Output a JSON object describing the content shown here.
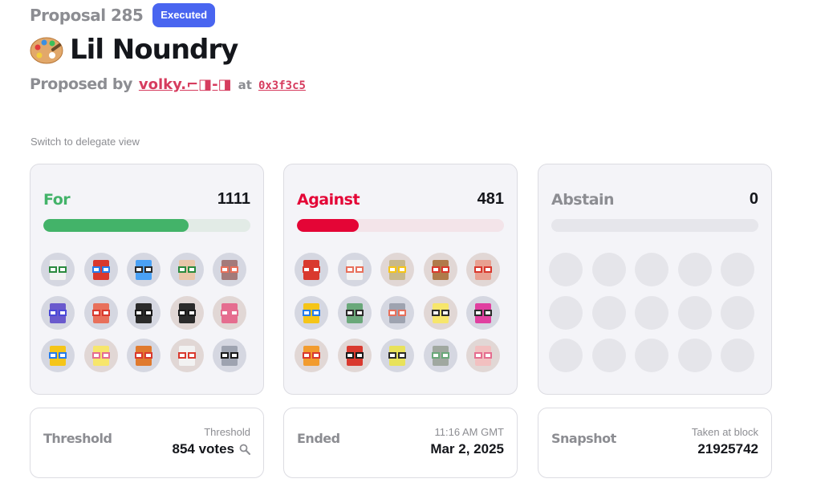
{
  "proposal": {
    "number_label": "Proposal 285",
    "status_badge": "Executed",
    "title": "Lil Noundry",
    "proposed_by_label": "Proposed by",
    "proposer": "volky.⌐◨-◨",
    "at_label": "at",
    "address": "0x3f3c5"
  },
  "switch_view": "Switch to delegate view",
  "votes": {
    "for": {
      "label": "For",
      "count": "1111",
      "fraction": 0.7,
      "color": "#43b369",
      "track": "#e2ebe6"
    },
    "against": {
      "label": "Against",
      "count": "481",
      "fraction": 0.3,
      "color": "#e40536",
      "track": "#f3e4e9"
    },
    "abstain": {
      "label": "Abstain",
      "count": "0",
      "fraction": 0,
      "color": "#8c8d92",
      "track": "#e6e6eb"
    }
  },
  "voter_avatars": {
    "for": [
      {
        "bg": "#d5d7e1",
        "head": "#f2f2f2",
        "glass": "#2b8a3e"
      },
      {
        "bg": "#d5d7e1",
        "head": "#d9392e",
        "glass": "#257ced"
      },
      {
        "bg": "#d5d7e1",
        "head": "#4aa1f5",
        "glass": "#2b2b2b"
      },
      {
        "bg": "#d5d7e1",
        "head": "#e9c6a8",
        "glass": "#2b8a3e"
      },
      {
        "bg": "#d5d7e1",
        "head": "#a37a7a",
        "glass": "#e8705b"
      },
      {
        "bg": "#d5d7e1",
        "head": "#6a5acd",
        "glass": "#4b49d8"
      },
      {
        "bg": "#d5d7e1",
        "head": "#e8705b",
        "glass": "#d9392e"
      },
      {
        "bg": "#d5d7e1",
        "head": "#2b2b2b",
        "glass": "#1a1a1a"
      },
      {
        "bg": "#e1d7d5",
        "head": "#2b2b2b",
        "glass": "#1a1a1a"
      },
      {
        "bg": "#e1d7d5",
        "head": "#e56d8f",
        "glass": "#e56d8f"
      },
      {
        "bg": "#d5d7e1",
        "head": "#f5c518",
        "glass": "#257ced"
      },
      {
        "bg": "#e1d7d5",
        "head": "#f7e66b",
        "glass": "#e56d8f"
      },
      {
        "bg": "#d5d7e1",
        "head": "#e07a2e",
        "glass": "#d9392e"
      },
      {
        "bg": "#e1d7d5",
        "head": "#f2f2f2",
        "glass": "#d9392e"
      },
      {
        "bg": "#d5d7e1",
        "head": "#9ea3b0",
        "glass": "#1a1a1a"
      }
    ],
    "against": [
      {
        "bg": "#d5d7e1",
        "head": "#d9392e",
        "glass": "#d9392e"
      },
      {
        "bg": "#d5d7e1",
        "head": "#f2f2f2",
        "glass": "#e8705b"
      },
      {
        "bg": "#e1d7d5",
        "head": "#c8b88a",
        "glass": "#f5c518"
      },
      {
        "bg": "#e1d7d5",
        "head": "#b07a4a",
        "glass": "#d9392e"
      },
      {
        "bg": "#e1d7d5",
        "head": "#e8a090",
        "glass": "#d9392e"
      },
      {
        "bg": "#d5d7e1",
        "head": "#f5c518",
        "glass": "#257ced"
      },
      {
        "bg": "#d5d7e1",
        "head": "#6aa87a",
        "glass": "#2b2b2b"
      },
      {
        "bg": "#d5d7e1",
        "head": "#9ea3b0",
        "glass": "#e8705b"
      },
      {
        "bg": "#e1d7d5",
        "head": "#f7e66b",
        "glass": "#2b2b2b"
      },
      {
        "bg": "#d5d7e1",
        "head": "#e040a0",
        "glass": "#2b2b2b"
      },
      {
        "bg": "#e1d7d5",
        "head": "#f29b2e",
        "glass": "#d9392e"
      },
      {
        "bg": "#e1d7d5",
        "head": "#d9392e",
        "glass": "#1a1a1a"
      },
      {
        "bg": "#d5d7e1",
        "head": "#e8e25a",
        "glass": "#2b2b2b"
      },
      {
        "bg": "#d5d7e1",
        "head": "#a0a8a0",
        "glass": "#6aa87a"
      },
      {
        "bg": "#e1d7d5",
        "head": "#f2c0c0",
        "glass": "#e56d8f"
      }
    ]
  },
  "info": {
    "threshold": {
      "label": "Threshold",
      "sub": "Threshold",
      "value": "854 votes"
    },
    "ended": {
      "label": "Ended",
      "sub": "11:16 AM GMT",
      "value": "Mar 2, 2025"
    },
    "snapshot": {
      "label": "Snapshot",
      "sub": "Taken at block",
      "value": "21925742"
    }
  },
  "icons": {
    "palette": "palette-emoji-icon",
    "search": "search-icon"
  }
}
